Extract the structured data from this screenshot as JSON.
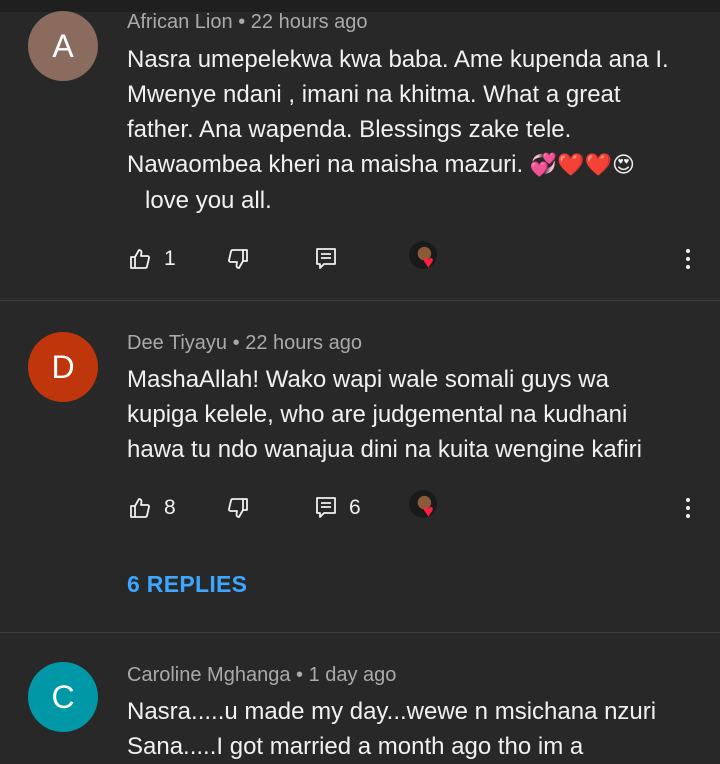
{
  "comments": [
    {
      "initial": "A",
      "avatar_color": "#8a6b5e",
      "author": "African Lion",
      "time": "22 hours ago",
      "lines": [
        "Nasra umepelekwa kwa baba. Ame kupenda ana I.",
        "Mwenye ndani , imani na khitma. What a great",
        "father. Ana wapenda. Blessings zake tele.",
        "Nawaombea kheri na maisha mazuri.",
        "love you all."
      ],
      "emoji": "💞❤️❤️😍",
      "likes": "1",
      "reply_count": ""
    },
    {
      "initial": "D",
      "avatar_color": "#bf360c",
      "author": "Dee Tiyayu",
      "time": "22 hours ago",
      "lines": [
        "MashaAllah! Wako wapi wale somali guys  wa",
        "kupiga kelele, who are judgemental na kudhani",
        "hawa tu ndo wanajua dini na kuita wengine kafiri"
      ],
      "likes": "8",
      "reply_count": "6",
      "replies_link": "6 REPLIES"
    },
    {
      "initial": "C",
      "avatar_color": "#0097a7",
      "author": "Caroline Mghanga",
      "time": "1 day ago",
      "lines": [
        "Nasra.....u made my day...wewe n msichana nzuri",
        "Sana.....I got married a month ago tho im a"
      ]
    }
  ],
  "separator": "•",
  "icons": {
    "like": "thumbs-up-icon",
    "dislike": "thumbs-down-icon",
    "reply": "reply-icon",
    "creator_heart": "creator-heart-icon",
    "menu": "more-vert-icon"
  },
  "colors": {
    "background": "#282828",
    "meta_text": "#aaaaaa",
    "link": "#3ea6ff",
    "heart": "#ff1f3d"
  }
}
